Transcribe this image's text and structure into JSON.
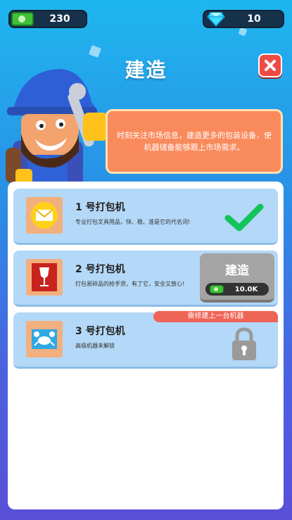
{
  "currency": {
    "cash_icon": "cash-icon",
    "cash_value": "230",
    "gem_icon": "diamond-icon",
    "gem_value": "10"
  },
  "header": {
    "title": "建造",
    "close_icon": "close-icon"
  },
  "tip": {
    "text": "时刻关注市场信息，建造更多的包装设备，使机器储备能够跟上市场需求。"
  },
  "machines": [
    {
      "number": "1",
      "name": "号打包机",
      "description": "专业打包文具用品，快、稳、准是它的代名词!",
      "status": "built",
      "icon": "envelope-icon"
    },
    {
      "number": "2",
      "name": "号打包机",
      "description": "打包易碎品的抢手货，有了它，安全又放心!",
      "status": "buildable",
      "icon": "wine-glass-icon",
      "build_label": "建造",
      "cost": "10.0K"
    },
    {
      "number": "3",
      "name": "号打包机",
      "description": "高级机器未解锁",
      "status": "locked",
      "icon": "crab-icon",
      "requirement": "需修建上一台机器"
    }
  ],
  "colors": {
    "accent_close": "#f04a44",
    "tip_bubble": "#f98a5c",
    "card_bg": "#b4d8f7",
    "check_green": "#12c45a",
    "requirement_red": "#ee6456"
  }
}
